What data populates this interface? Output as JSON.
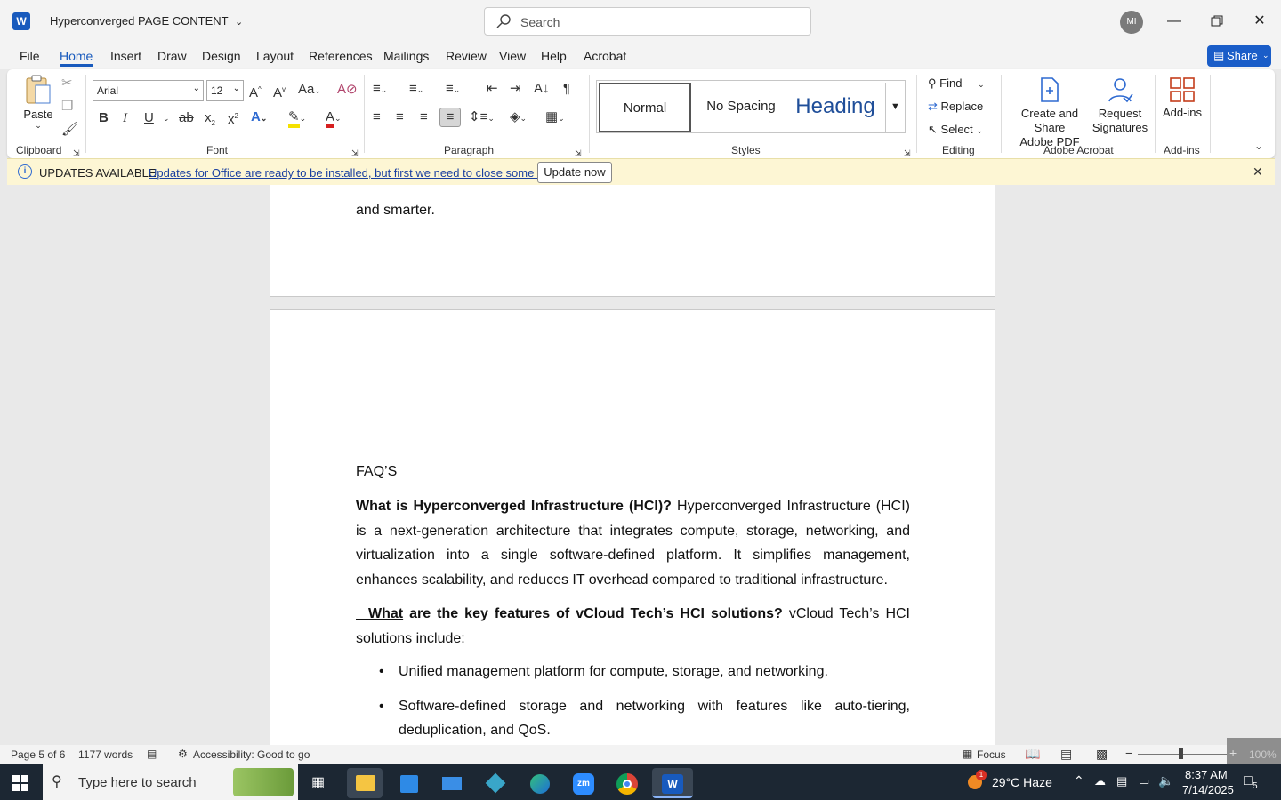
{
  "titlebar": {
    "app_logo": "W",
    "doc_title": "Hyperconverged PAGE CONTENT",
    "search_placeholder": "Search",
    "avatar_initials": "MI"
  },
  "menu_tabs": [
    "File",
    "Home",
    "Insert",
    "Draw",
    "Design",
    "Layout",
    "References",
    "Mailings",
    "Review",
    "View",
    "Help",
    "Acrobat"
  ],
  "share_label": "Share",
  "ribbon": {
    "clipboard": {
      "paste_label": "Paste",
      "group_label": "Clipboard"
    },
    "font": {
      "font_name": "Arial",
      "font_size": "12",
      "group_label": "Font"
    },
    "paragraph": {
      "group_label": "Paragraph"
    },
    "styles": {
      "items": [
        "Normal",
        "No Spacing",
        "Heading"
      ],
      "group_label": "Styles"
    },
    "editing": {
      "find": "Find",
      "replace": "Replace",
      "select": "Select",
      "group_label": "Editing"
    },
    "acrobat": {
      "create_share": [
        "Create and Share",
        "Adobe PDF"
      ],
      "request": [
        "Request",
        "Signatures"
      ],
      "group_label": "Adobe Acrobat"
    },
    "addins": {
      "label": "Add-ins",
      "group_label": "Add-ins"
    }
  },
  "infobar": {
    "title": "UPDATES AVAILABLE",
    "message": "Updates for Office are ready to be installed, but first we need to close some apps.",
    "button": "Update now"
  },
  "document": {
    "page1_tail": "and smarter.",
    "faq_heading": "FAQ’S",
    "q1_bold": "What is Hyperconverged Infrastructure (HCI)?",
    "q1_answer": "Hyperconverged Infrastructure (HCI) is a next-generation architecture that integrates compute, storage, networking, and virtualization into a single software-defined platform. It simplifies management, enhances scalability, and reduces IT overhead compared to traditional infrastructure.",
    "q2_glyph": "",
    "q2_what": "What",
    "q2_bold_rest": " are the key features of vCloud Tech’s HCI solutions?",
    "q2_answer": "vCloud Tech’s HCI solutions include:",
    "bullets": [
      "Unified management platform for compute, storage, and networking.",
      "Software-defined storage and networking with features like auto-tiering, deduplication, and QoS."
    ]
  },
  "statusbar": {
    "page": "Page 5 of 6",
    "words": "1177 words",
    "accessibility": "Accessibility: Good to go",
    "focus": "Focus",
    "zoom": "100%"
  },
  "taskbar": {
    "search_placeholder": "Type here to search",
    "weather": "29°C  Haze",
    "time": "8:37 AM",
    "date": "7/14/2025",
    "weather_badge": "1",
    "notification_count": "5"
  }
}
